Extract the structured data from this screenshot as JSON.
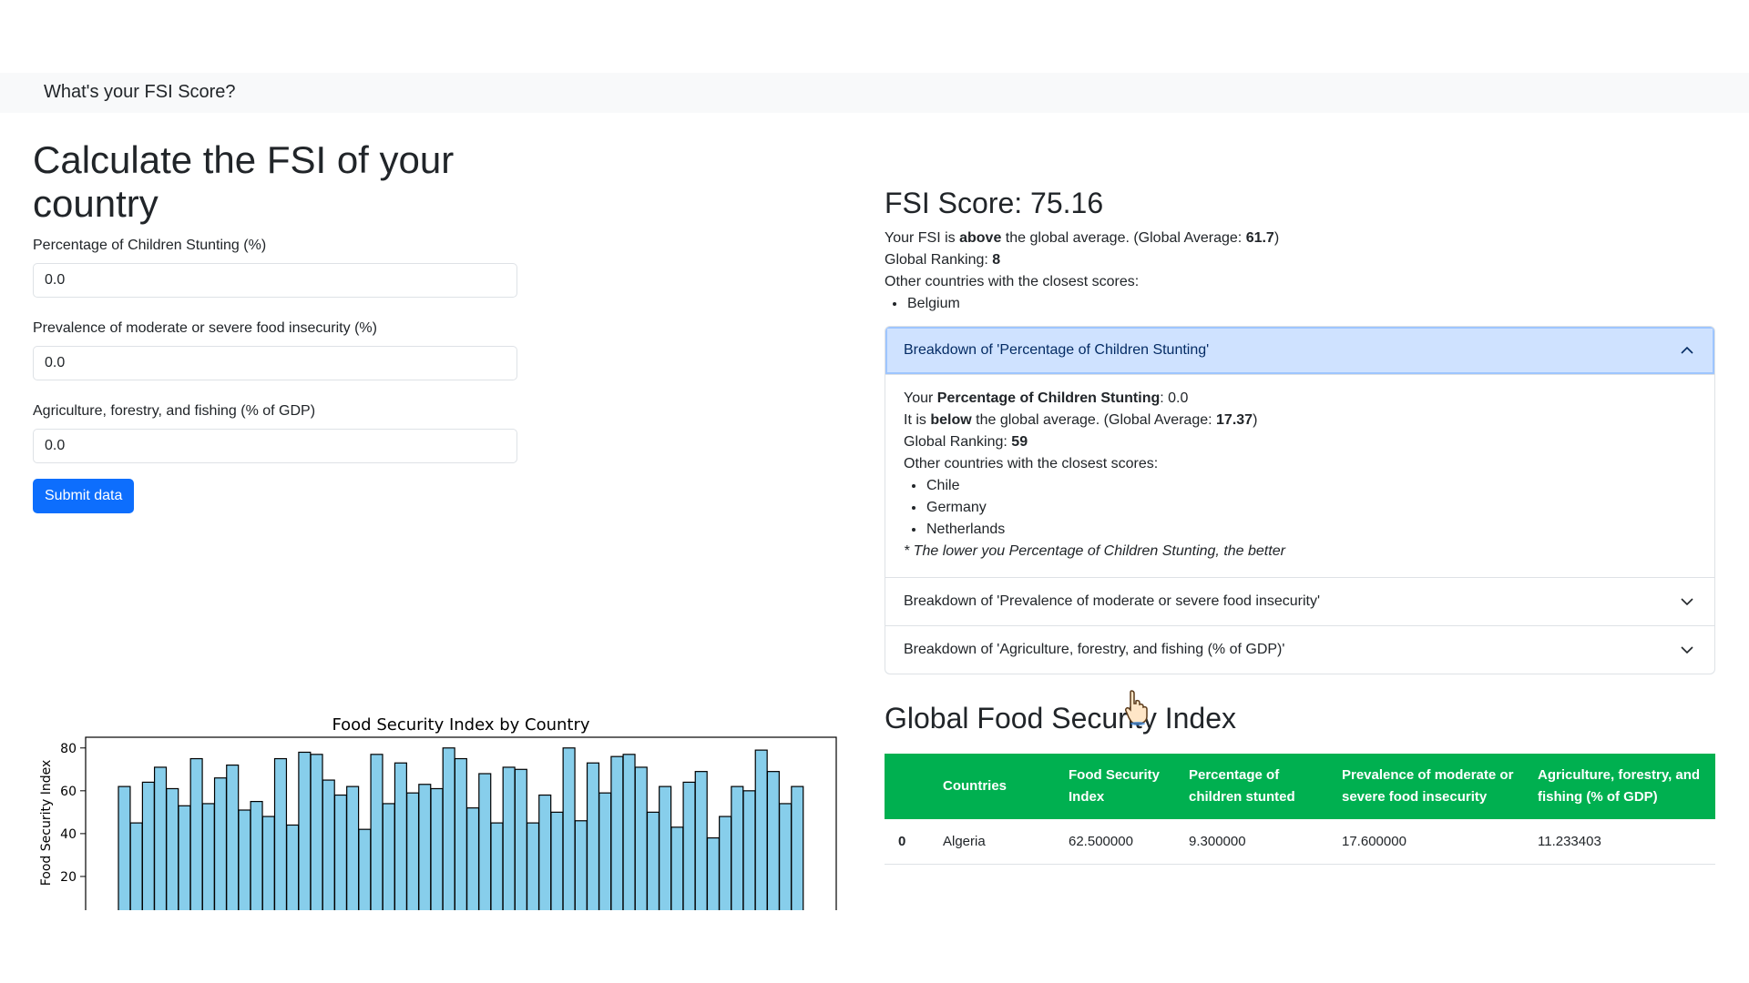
{
  "navbar": {
    "brand": "What's your FSI Score?"
  },
  "form": {
    "title": "Calculate the FSI of your country",
    "fields": [
      {
        "label": "Percentage of Children Stunting (%)",
        "value": "0.0"
      },
      {
        "label": "Prevalence of moderate or severe food insecurity (%)",
        "value": "0.0"
      },
      {
        "label": "Agriculture, forestry, and fishing (% of GDP)",
        "value": "0.0"
      }
    ],
    "submit_label": "Submit data"
  },
  "result": {
    "score_title": "FSI Score: 75.16",
    "avg_prefix": "Your FSI is ",
    "avg_relation": "above",
    "avg_middle": " the global average. (Global Average: ",
    "avg_value": "61.7",
    "avg_suffix": ")",
    "ranking_label": "Global Ranking: ",
    "ranking_value": "8",
    "closest_label": "Other countries with the closest scores:",
    "closest": [
      "Belgium"
    ]
  },
  "accordion": {
    "items": [
      {
        "title": "Breakdown of 'Percentage of Children Stunting'",
        "expanded": true
      },
      {
        "title": "Breakdown of 'Prevalence of moderate or severe food insecurity'",
        "expanded": false
      },
      {
        "title": "Breakdown of 'Agriculture, forestry, and fishing (% of GDP)'",
        "expanded": false
      }
    ],
    "body": {
      "your_prefix": "Your ",
      "your_metric": "Percentage of Children Stunting",
      "your_sep": ": ",
      "your_value": "0.0",
      "rel_prefix": "It is ",
      "rel_word": "below",
      "rel_middle": " the global average. (Global Average: ",
      "rel_avg": "17.37",
      "rel_suffix": ")",
      "ranking_label": "Global Ranking: ",
      "ranking_value": "59",
      "closest_label": "Other countries with the closest scores:",
      "closest": [
        "Chile",
        "Germany",
        "Netherlands"
      ],
      "note": "* The lower you Percentage of Children Stunting, the better"
    }
  },
  "table": {
    "title": "Global Food Security Index",
    "headers": [
      "",
      "Countries",
      "Food Security Index",
      "Percentage of children stunted",
      "Prevalence of moderate or severe food insecurity",
      "Agriculture, forestry, and fishing (% of GDP)"
    ],
    "rows": [
      [
        "0",
        "Algeria",
        "62.500000",
        "9.300000",
        "17.600000",
        "11.233403"
      ]
    ],
    "header_color": "#00b050"
  },
  "colors": {
    "accent": "#0d6efd",
    "accordion_open": "#cfe2ff",
    "bar_fill": "#87ceeb"
  },
  "icons": {
    "accordion_open": "chevron-up-icon",
    "accordion_closed": "chevron-down-icon",
    "cursor": "hand-pointer-icon"
  },
  "chart_data": {
    "type": "bar",
    "title": "Food Security Index by Country",
    "ylabel": "Food Security Index",
    "xlabel": "",
    "ylim": [
      0,
      85
    ],
    "yticks": [
      20,
      40,
      60,
      80
    ],
    "values": [
      62,
      45,
      64,
      71,
      61,
      53,
      75,
      54,
      66,
      72,
      51,
      55,
      48,
      75,
      44,
      78,
      77,
      65,
      58,
      62,
      42,
      77,
      54,
      73,
      59,
      63,
      61,
      80,
      75,
      52,
      68,
      45,
      71,
      70,
      45,
      58,
      50,
      80,
      46,
      73,
      59,
      76,
      77,
      71,
      50,
      62,
      43,
      64,
      69,
      38,
      48,
      62,
      60,
      79,
      69,
      54,
      62
    ]
  },
  "chart_labels": {
    "y20": "20",
    "y40": "40",
    "y60": "60",
    "y80": "80"
  }
}
